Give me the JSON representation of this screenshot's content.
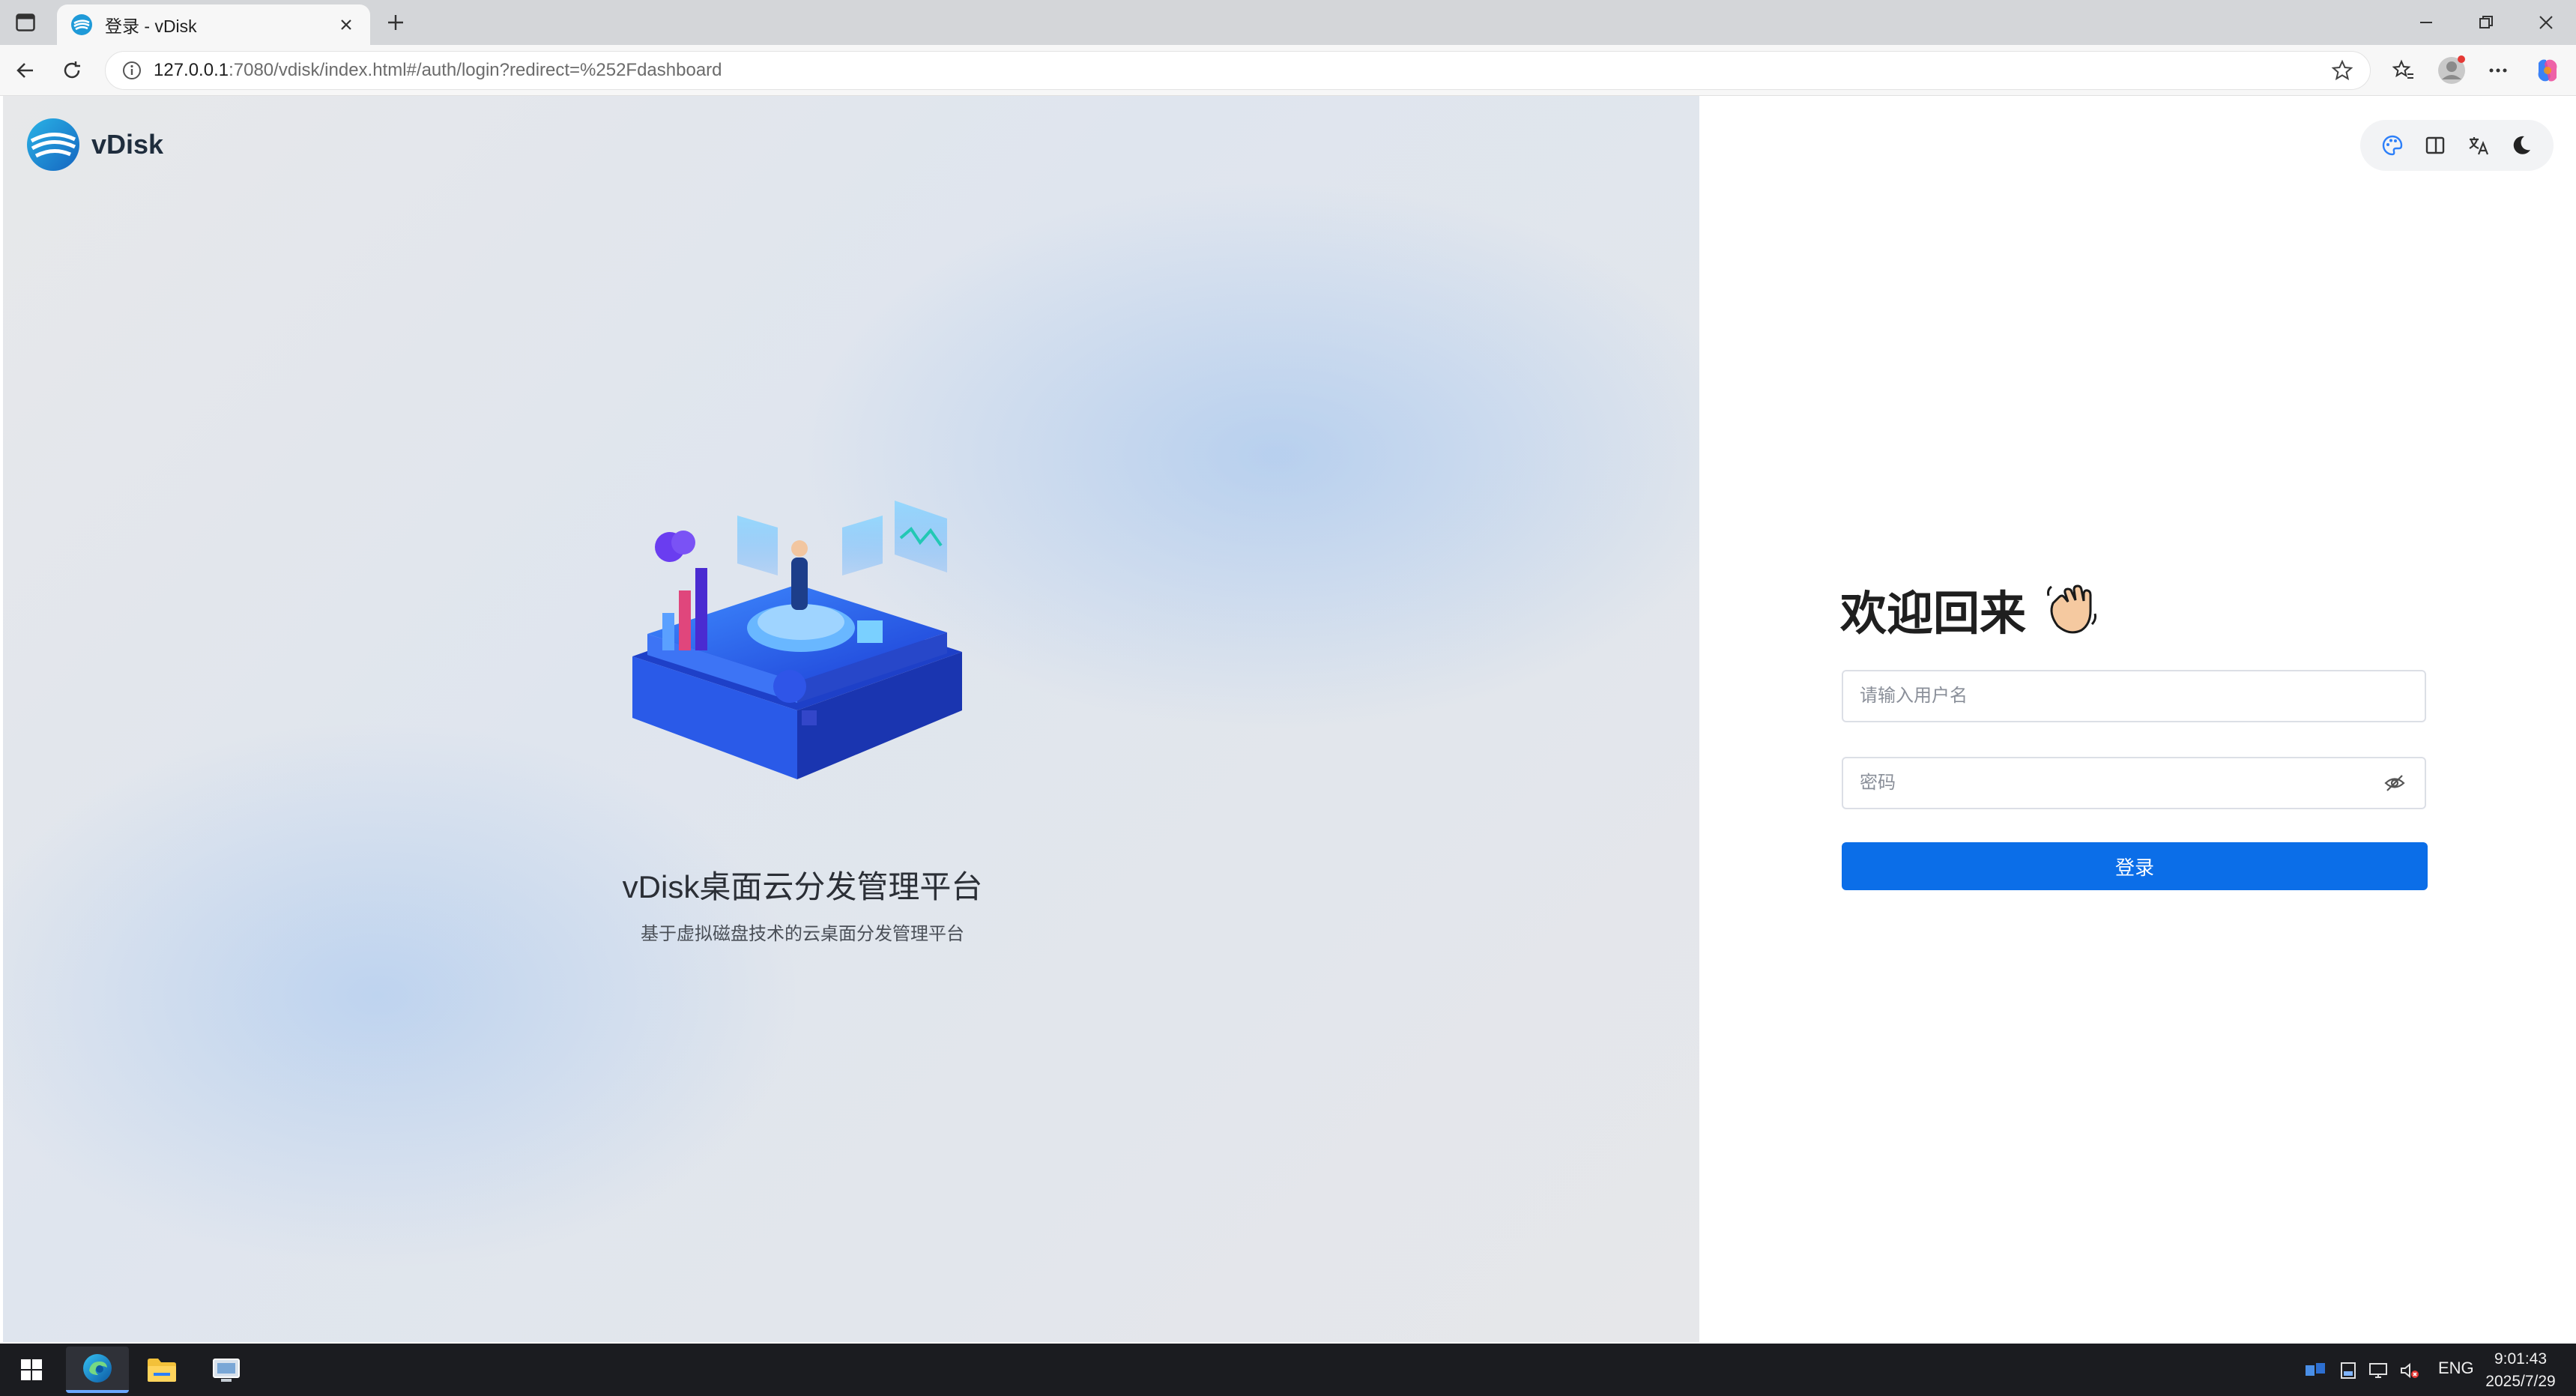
{
  "browser": {
    "tab_title": "登录 - vDisk",
    "url_host": "127.0.0.1",
    "url_rest": ":7080/vdisk/index.html#/auth/login?redirect=%252Fdashboard"
  },
  "brand": {
    "name": "vDisk"
  },
  "hero": {
    "title": "vDisk桌面云分发管理平台",
    "subtitle": "基于虚拟磁盘技术的云桌面分发管理平台"
  },
  "login": {
    "welcome": "欢迎回来",
    "username_placeholder": "请输入用户名",
    "password_placeholder": "密码",
    "submit_label": "登录"
  },
  "taskbar": {
    "lang": "ENG",
    "time": "9:01:43",
    "date": "2025/7/29"
  },
  "colors": {
    "primary": "#0b6ee8",
    "brand": "#1f9ad8",
    "taskbar": "#1b1c20"
  },
  "icons": [
    "sidebar-toggle-icon",
    "tab-favicon",
    "close-icon",
    "plus-icon",
    "minimize-icon",
    "restore-icon",
    "back-icon",
    "reload-icon",
    "info-icon",
    "star-icon",
    "favorites-icon",
    "profile-icon",
    "more-icon",
    "copilot-icon",
    "palette-icon",
    "layout-icon",
    "translate-icon",
    "moon-icon",
    "waving-hand-icon",
    "eye-off-icon",
    "windows-start-icon",
    "edge-icon",
    "explorer-icon",
    "app-icon"
  ]
}
